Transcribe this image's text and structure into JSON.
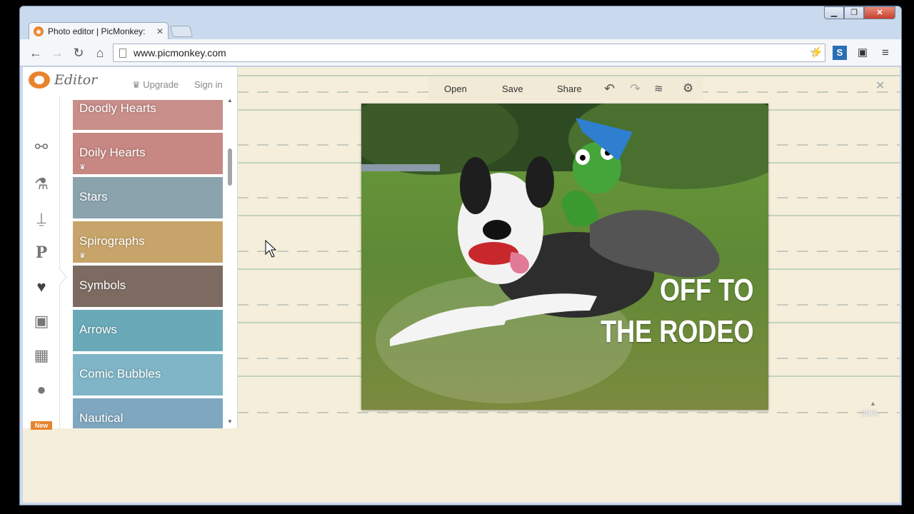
{
  "browser": {
    "tab_title": "Photo editor | PicMonkey: ",
    "url": "www.picmonkey.com",
    "win_min": "▁",
    "win_max": "❐",
    "win_close": "✕"
  },
  "app": {
    "brand": "Editor",
    "upgrade_label": "Upgrade",
    "signin_label": "Sign in",
    "new_badge": "New",
    "categories": [
      {
        "label": "Doodly Hearts",
        "premium": false,
        "color": "#c98f8a"
      },
      {
        "label": "Doily Hearts",
        "premium": true,
        "color": "#c78782"
      },
      {
        "label": "Stars",
        "premium": false,
        "color": "#8aa3ad"
      },
      {
        "label": "Spirographs",
        "premium": true,
        "color": "#c7a56a"
      },
      {
        "label": "Symbols",
        "premium": false,
        "color": "#7d6b62"
      },
      {
        "label": "Arrows",
        "premium": false,
        "color": "#6aaab8"
      },
      {
        "label": "Comic Bubbles",
        "premium": false,
        "color": "#7fb5c6"
      },
      {
        "label": "Nautical",
        "premium": false,
        "color": "#7fa7c0"
      }
    ]
  },
  "edit_toolbar": {
    "open_label": "Open",
    "save_label": "Save",
    "share_label": "Share"
  },
  "canvas": {
    "caption_line1": "OFF TO",
    "caption_line2": "THE RODEO",
    "zoom": "36%"
  }
}
